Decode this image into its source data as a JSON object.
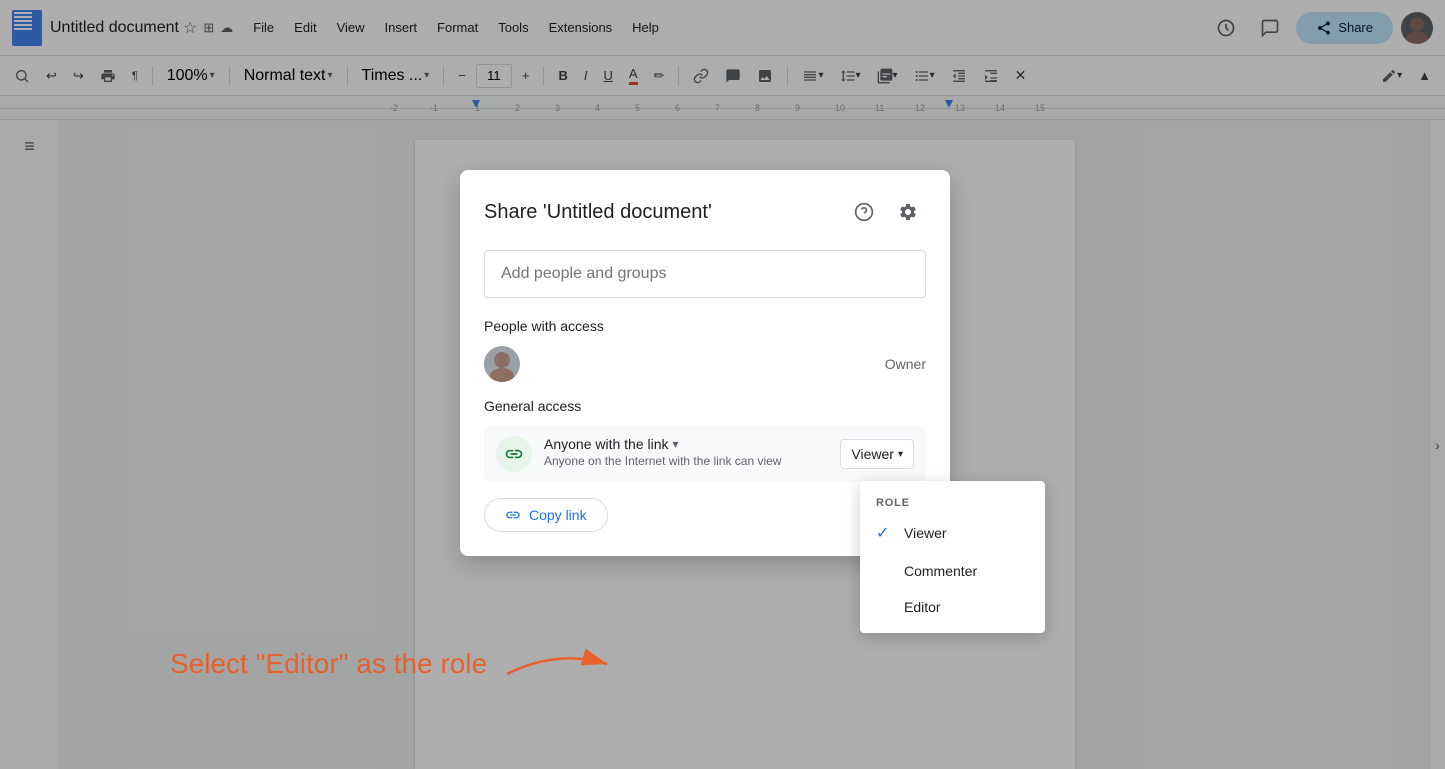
{
  "app": {
    "title": "Untitled document",
    "title_icons": [
      "★",
      "🖼",
      "☁"
    ],
    "menu": [
      "File",
      "Edit",
      "View",
      "Insert",
      "Format",
      "Tools",
      "Extensions",
      "Help"
    ]
  },
  "toolbar": {
    "zoom": "100%",
    "style": "Normal text",
    "font": "Times ...",
    "font_size": "11",
    "buttons": [
      "🔍",
      "↩",
      "↪",
      "🖨",
      "¶",
      "⊞",
      "B",
      "I",
      "U",
      "A",
      "✏",
      "🔗",
      "🖼",
      "≡",
      "☰",
      "⋮",
      "≣",
      "⇥",
      "⇤",
      "✕"
    ]
  },
  "top_right": {
    "share_label": "Share",
    "share_icon": "👤"
  },
  "share_dialog": {
    "title": "Share 'Untitled document'",
    "help_icon": "?",
    "settings_icon": "⚙",
    "input_placeholder": "Add people and groups",
    "people_section": "People with access",
    "owner_label": "Owner",
    "general_access_section": "General access",
    "access_type": "Anyone with the link",
    "access_description": "Anyone on the Internet with the link can view",
    "role_label": "Viewer",
    "copy_link_label": "Copy link"
  },
  "role_dropdown": {
    "header": "ROLE",
    "items": [
      {
        "label": "Viewer",
        "selected": true
      },
      {
        "label": "Commenter",
        "selected": false
      },
      {
        "label": "Editor",
        "selected": false
      }
    ]
  },
  "annotation": {
    "text": "Select \"Editor\" as the role",
    "arrow": "→"
  },
  "colors": {
    "blue_accent": "#1a73e8",
    "share_btn_bg": "#c2e7ff",
    "annotation_color": "#e8602c"
  }
}
